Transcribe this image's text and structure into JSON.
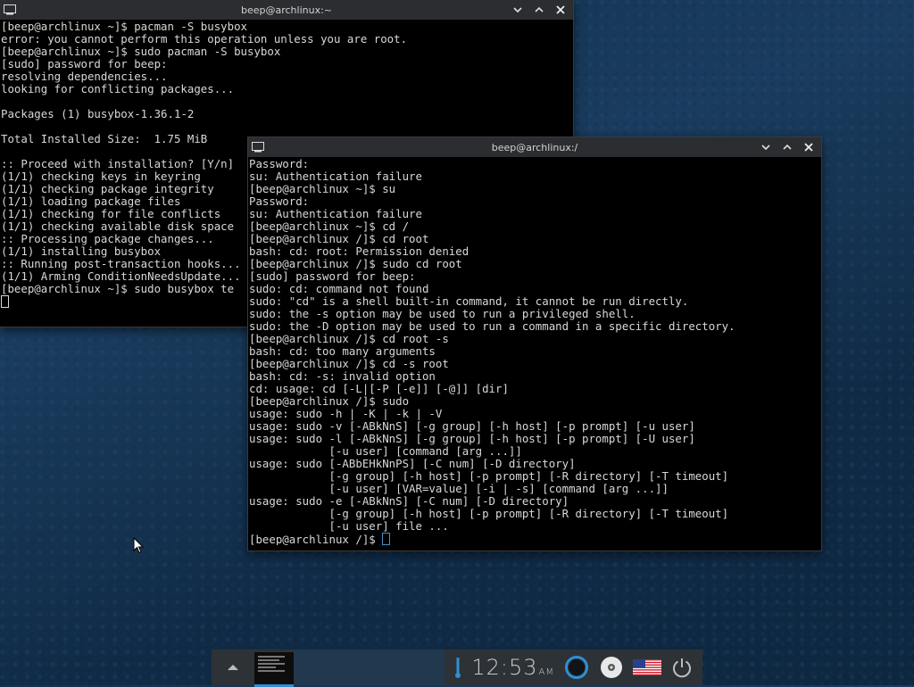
{
  "windows": [
    {
      "title": "beep@archlinux:~",
      "lines": [
        "[beep@archlinux ~]$ pacman -S busybox",
        "error: you cannot perform this operation unless you are root.",
        "[beep@archlinux ~]$ sudo pacman -S busybox",
        "[sudo] password for beep:",
        "resolving dependencies...",
        "looking for conflicting packages...",
        "",
        "Packages (1) busybox-1.36.1-2",
        "",
        "Total Installed Size:  1.75 MiB",
        "",
        ":: Proceed with installation? [Y/n]",
        "(1/1) checking keys in keyring",
        "(1/1) checking package integrity",
        "(1/1) loading package files",
        "(1/1) checking for file conflicts",
        "(1/1) checking available disk space",
        ":: Processing package changes...",
        "(1/1) installing busybox",
        ":: Running post-transaction hooks...",
        "(1/1) Arming ConditionNeedsUpdate...",
        "[beep@archlinux ~]$ sudo busybox te"
      ]
    },
    {
      "title": "beep@archlinux:/",
      "lines": [
        "Password:",
        "su: Authentication failure",
        "[beep@archlinux ~]$ su",
        "Password:",
        "su: Authentication failure",
        "[beep@archlinux ~]$ cd /",
        "[beep@archlinux /]$ cd root",
        "bash: cd: root: Permission denied",
        "[beep@archlinux /]$ sudo cd root",
        "[sudo] password for beep:",
        "sudo: cd: command not found",
        "sudo: \"cd\" is a shell built-in command, it cannot be run directly.",
        "sudo: the -s option may be used to run a privileged shell.",
        "sudo: the -D option may be used to run a command in a specific directory.",
        "[beep@archlinux /]$ cd root -s",
        "bash: cd: too many arguments",
        "[beep@archlinux /]$ cd -s root",
        "bash: cd: -s: invalid option",
        "cd: usage: cd [-L|[-P [-e]] [-@]] [dir]",
        "[beep@archlinux /]$ sudo",
        "usage: sudo -h | -K | -k | -V",
        "usage: sudo -v [-ABkNnS] [-g group] [-h host] [-p prompt] [-u user]",
        "usage: sudo -l [-ABkNnS] [-g group] [-h host] [-p prompt] [-U user]",
        "            [-u user] [command [arg ...]]",
        "usage: sudo [-ABbEHkNnPS] [-C num] [-D directory]",
        "            [-g group] [-h host] [-p prompt] [-R directory] [-T timeout]",
        "            [-u user] [VAR=value] [-i | -s] [command [arg ...]]",
        "usage: sudo -e [-ABkNnS] [-C num] [-D directory]",
        "            [-g group] [-h host] [-p prompt] [-R directory] [-T timeout]",
        "            [-u user] file ...",
        "[beep@archlinux /]$ "
      ]
    }
  ],
  "taskbar": {
    "clock": {
      "time": "12:53",
      "ampm": "AM"
    }
  },
  "colors": {
    "terminal_bg": "#000000",
    "terminal_fg": "#d8d8d8",
    "titlebar": "#2b2d30",
    "accent": "#2e8fd6"
  }
}
